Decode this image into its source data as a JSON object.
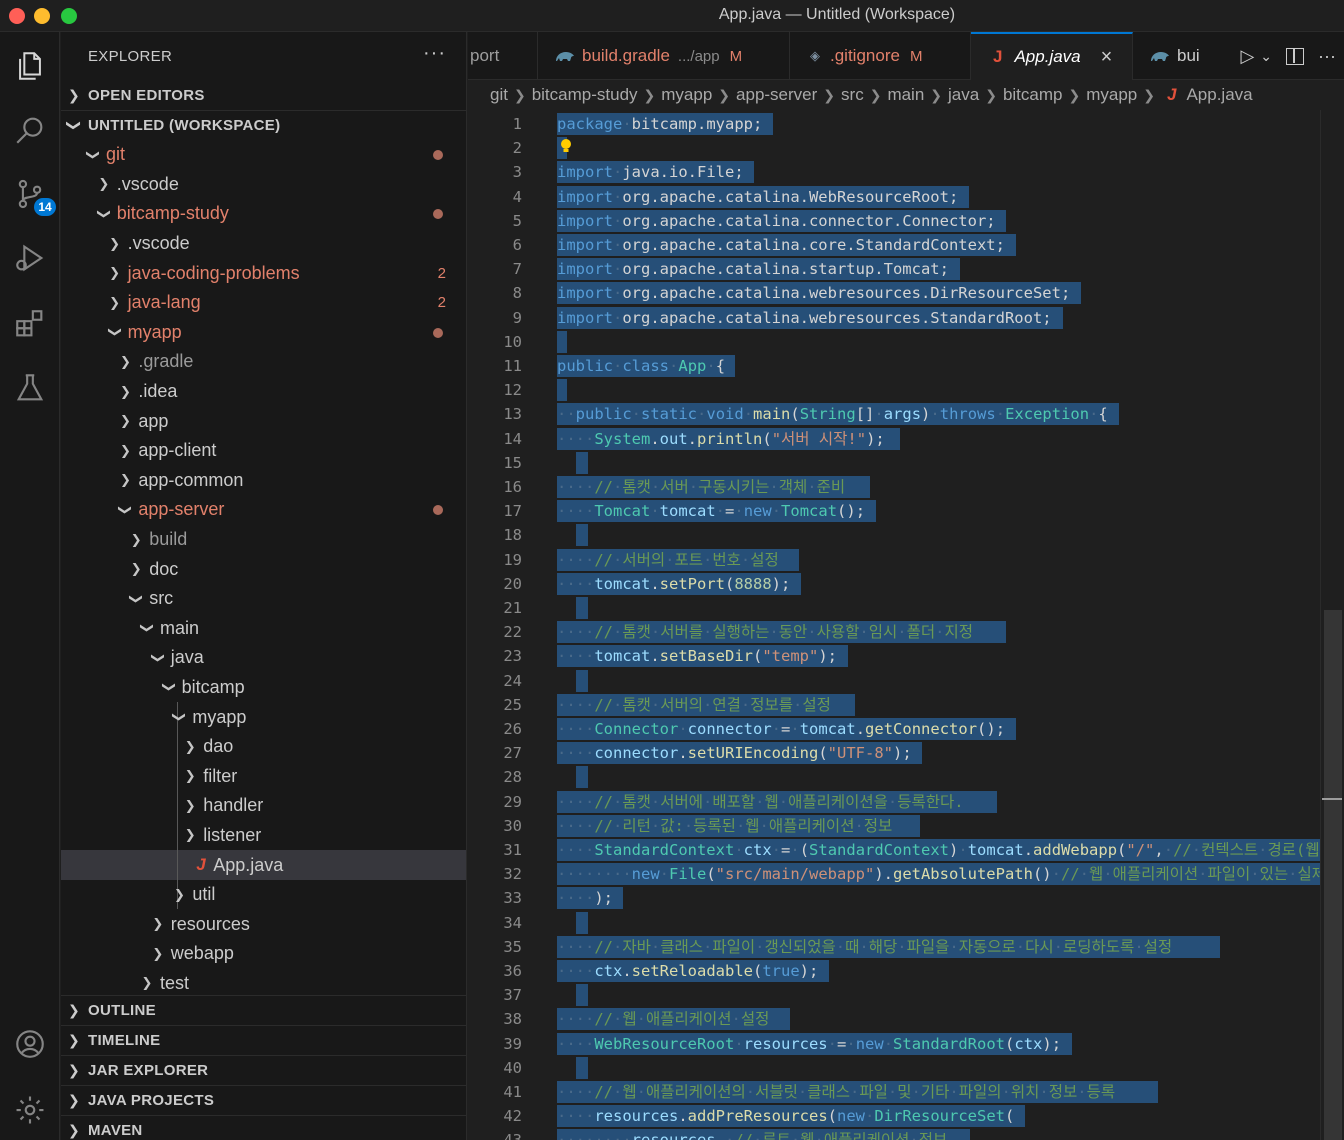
{
  "window": {
    "title": "App.java — Untitled (Workspace)"
  },
  "activity_bar": {
    "scm_badge": "14"
  },
  "sidebar": {
    "title": "EXPLORER",
    "more_actions": "···",
    "open_editors": "OPEN EDITORS",
    "workspace": "UNTITLED (WORKSPACE)",
    "tree": [
      {
        "label": "git",
        "depth": 0,
        "expanded": true,
        "modified": true,
        "badge": "dot"
      },
      {
        "label": ".vscode",
        "depth": 1,
        "expanded": false,
        "modified": false
      },
      {
        "label": "bitcamp-study",
        "depth": 1,
        "expanded": true,
        "modified": true,
        "badge": "dot"
      },
      {
        "label": ".vscode",
        "depth": 2,
        "expanded": false,
        "modified": false
      },
      {
        "label": "java-coding-problems",
        "depth": 2,
        "expanded": false,
        "modified": true,
        "badge": "2"
      },
      {
        "label": "java-lang",
        "depth": 2,
        "expanded": false,
        "modified": true,
        "badge": "2"
      },
      {
        "label": "myapp",
        "depth": 2,
        "expanded": true,
        "modified": true,
        "badge": "dot"
      },
      {
        "label": ".gradle",
        "depth": 3,
        "expanded": false,
        "modified": false,
        "dim": true
      },
      {
        "label": ".idea",
        "depth": 3,
        "expanded": false,
        "modified": false
      },
      {
        "label": "app",
        "depth": 3,
        "expanded": false,
        "modified": false
      },
      {
        "label": "app-client",
        "depth": 3,
        "expanded": false,
        "modified": false
      },
      {
        "label": "app-common",
        "depth": 3,
        "expanded": false,
        "modified": false
      },
      {
        "label": "app-server",
        "depth": 3,
        "expanded": true,
        "modified": true,
        "badge": "dot"
      },
      {
        "label": "build",
        "depth": 4,
        "expanded": false,
        "modified": false,
        "dim": true
      },
      {
        "label": "doc",
        "depth": 4,
        "expanded": false,
        "modified": false
      },
      {
        "label": "src",
        "depth": 4,
        "expanded": true,
        "modified": false
      },
      {
        "label": "main",
        "depth": 5,
        "expanded": true,
        "modified": false
      },
      {
        "label": "java",
        "depth": 6,
        "expanded": true,
        "modified": false
      },
      {
        "label": "bitcamp",
        "depth": 7,
        "expanded": true,
        "modified": false
      },
      {
        "label": "myapp",
        "depth": 8,
        "expanded": true,
        "modified": false
      },
      {
        "label": "dao",
        "depth": 9,
        "expanded": false,
        "modified": false
      },
      {
        "label": "filter",
        "depth": 9,
        "expanded": false,
        "modified": false
      },
      {
        "label": "handler",
        "depth": 9,
        "expanded": false,
        "modified": false
      },
      {
        "label": "listener",
        "depth": 9,
        "expanded": false,
        "modified": false
      },
      {
        "label": "App.java",
        "depth": 9,
        "file": true,
        "selected": true
      },
      {
        "label": "util",
        "depth": 8,
        "expanded": false,
        "modified": false
      },
      {
        "label": "resources",
        "depth": 6,
        "expanded": false,
        "modified": false
      },
      {
        "label": "webapp",
        "depth": 6,
        "expanded": false,
        "modified": false
      },
      {
        "label": "test",
        "depth": 5,
        "expanded": false,
        "modified": false
      }
    ],
    "sections": [
      "OUTLINE",
      "TIMELINE",
      "JAR EXPLORER",
      "JAVA PROJECTS",
      "MAVEN"
    ]
  },
  "tabs": [
    {
      "label": "port",
      "modified": false,
      "active": false
    },
    {
      "label": "build.gradle",
      "path": ".../app",
      "status": "M",
      "active": false
    },
    {
      "label": ".gitignore",
      "status": "M",
      "active": false
    },
    {
      "label": "App.java",
      "active": true,
      "close": "×"
    },
    {
      "label": "bui",
      "active": false
    }
  ],
  "tab_actions": {
    "run": "▷",
    "run_dropdown": "⌄",
    "split": "▯",
    "more": "···"
  },
  "breadcrumb": [
    "git",
    "bitcamp-study",
    "myapp",
    "app-server",
    "src",
    "main",
    "java",
    "bitcamp",
    "myapp",
    "App.java"
  ],
  "code_lines": [
    "package bitcamp.myapp;",
    "",
    "import java.io.File;",
    "import org.apache.catalina.WebResourceRoot;",
    "import org.apache.catalina.connector.Connector;",
    "import org.apache.catalina.core.StandardContext;",
    "import org.apache.catalina.startup.Tomcat;",
    "import org.apache.catalina.webresources.DirResourceSet;",
    "import org.apache.catalina.webresources.StandardRoot;",
    "",
    "public class App {",
    "",
    "  public static void main(String[] args) throws Exception {",
    "    System.out.println(\"서버 시작!\");",
    "",
    "    // 톰캣 서버 구동시키는 객체 준비",
    "    Tomcat tomcat = new Tomcat();",
    "",
    "    // 서버의 포트 번호 설정",
    "    tomcat.setPort(8888);",
    "",
    "    // 톰캣 서버를 실행하는 동안 사용할 임시 폴더 지정",
    "    tomcat.setBaseDir(\"temp\");",
    "",
    "    // 톰캣 서버의 연결 정보를 설정",
    "    Connector connector = tomcat.getConnector();",
    "    connector.setURIEncoding(\"UTF-8\");",
    "",
    "    // 톰캣 서버에 배포할 웹 애플리케이션을 등록한다.",
    "    // 리턴 값: 등록된 웹 애플리케이션 정보",
    "    StandardContext ctx = (StandardContext) tomcat.addWebapp(\"/\", // 컨텍스트 경로(웹",
    "        new File(\"src/main/webapp\").getAbsolutePath() // 웹 애플리케이션 파일이 있는 실제",
    "    );",
    "",
    "    // 자바 클래스 파일이 갱신되었을 때 해당 파일을 자동으로 다시 로딩하도록 설정",
    "    ctx.setReloadable(true);",
    "",
    "    // 웹 애플리케이션 설정",
    "    WebResourceRoot resources = new StandardRoot(ctx);",
    "",
    "    // 웹 애플리케이션의 서블릿 클래스 파일 및 기타 파일의 위치 정보 등록",
    "    resources.addPreResources(new DirResourceSet(",
    "        resources, // 루트 웹 애플리케이션 정보"
  ],
  "colors": {
    "selection": "#264f78",
    "keyword": "#569cd6",
    "type": "#4ec9b0",
    "function": "#dcdcaa",
    "variable": "#9cdcfe",
    "string": "#ce9178",
    "number": "#b5cea8",
    "comment": "#6a9955",
    "git_modified": "#e2816b",
    "accent": "#0078d4"
  }
}
